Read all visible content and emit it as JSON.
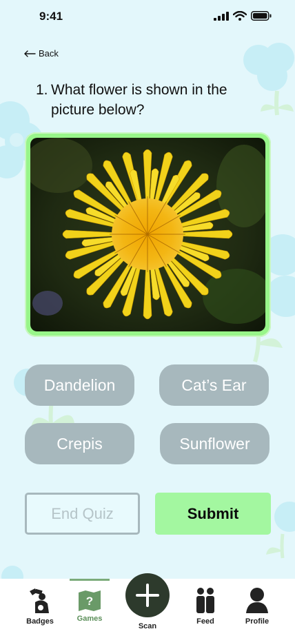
{
  "status_bar": {
    "time": "9:41"
  },
  "back": {
    "label": "Back"
  },
  "question": {
    "number": "1.",
    "text": "What flower is shown in the picture below?"
  },
  "options": [
    {
      "label": "Dandelion"
    },
    {
      "label": "Cat’s Ear"
    },
    {
      "label": "Crepis"
    },
    {
      "label": "Sunflower"
    }
  ],
  "actions": {
    "end_quiz": "End Quiz",
    "submit": "Submit"
  },
  "nav": {
    "badges": "Badges",
    "games": "Games",
    "scan": "Scan",
    "feed": "Feed",
    "profile": "Profile",
    "active": "games"
  },
  "colors": {
    "background": "#e3f7fb",
    "option": "#a7b8bd",
    "submit": "#a3f7a0",
    "frame": "#98f58a",
    "active_nav": "#5c8f5a"
  }
}
